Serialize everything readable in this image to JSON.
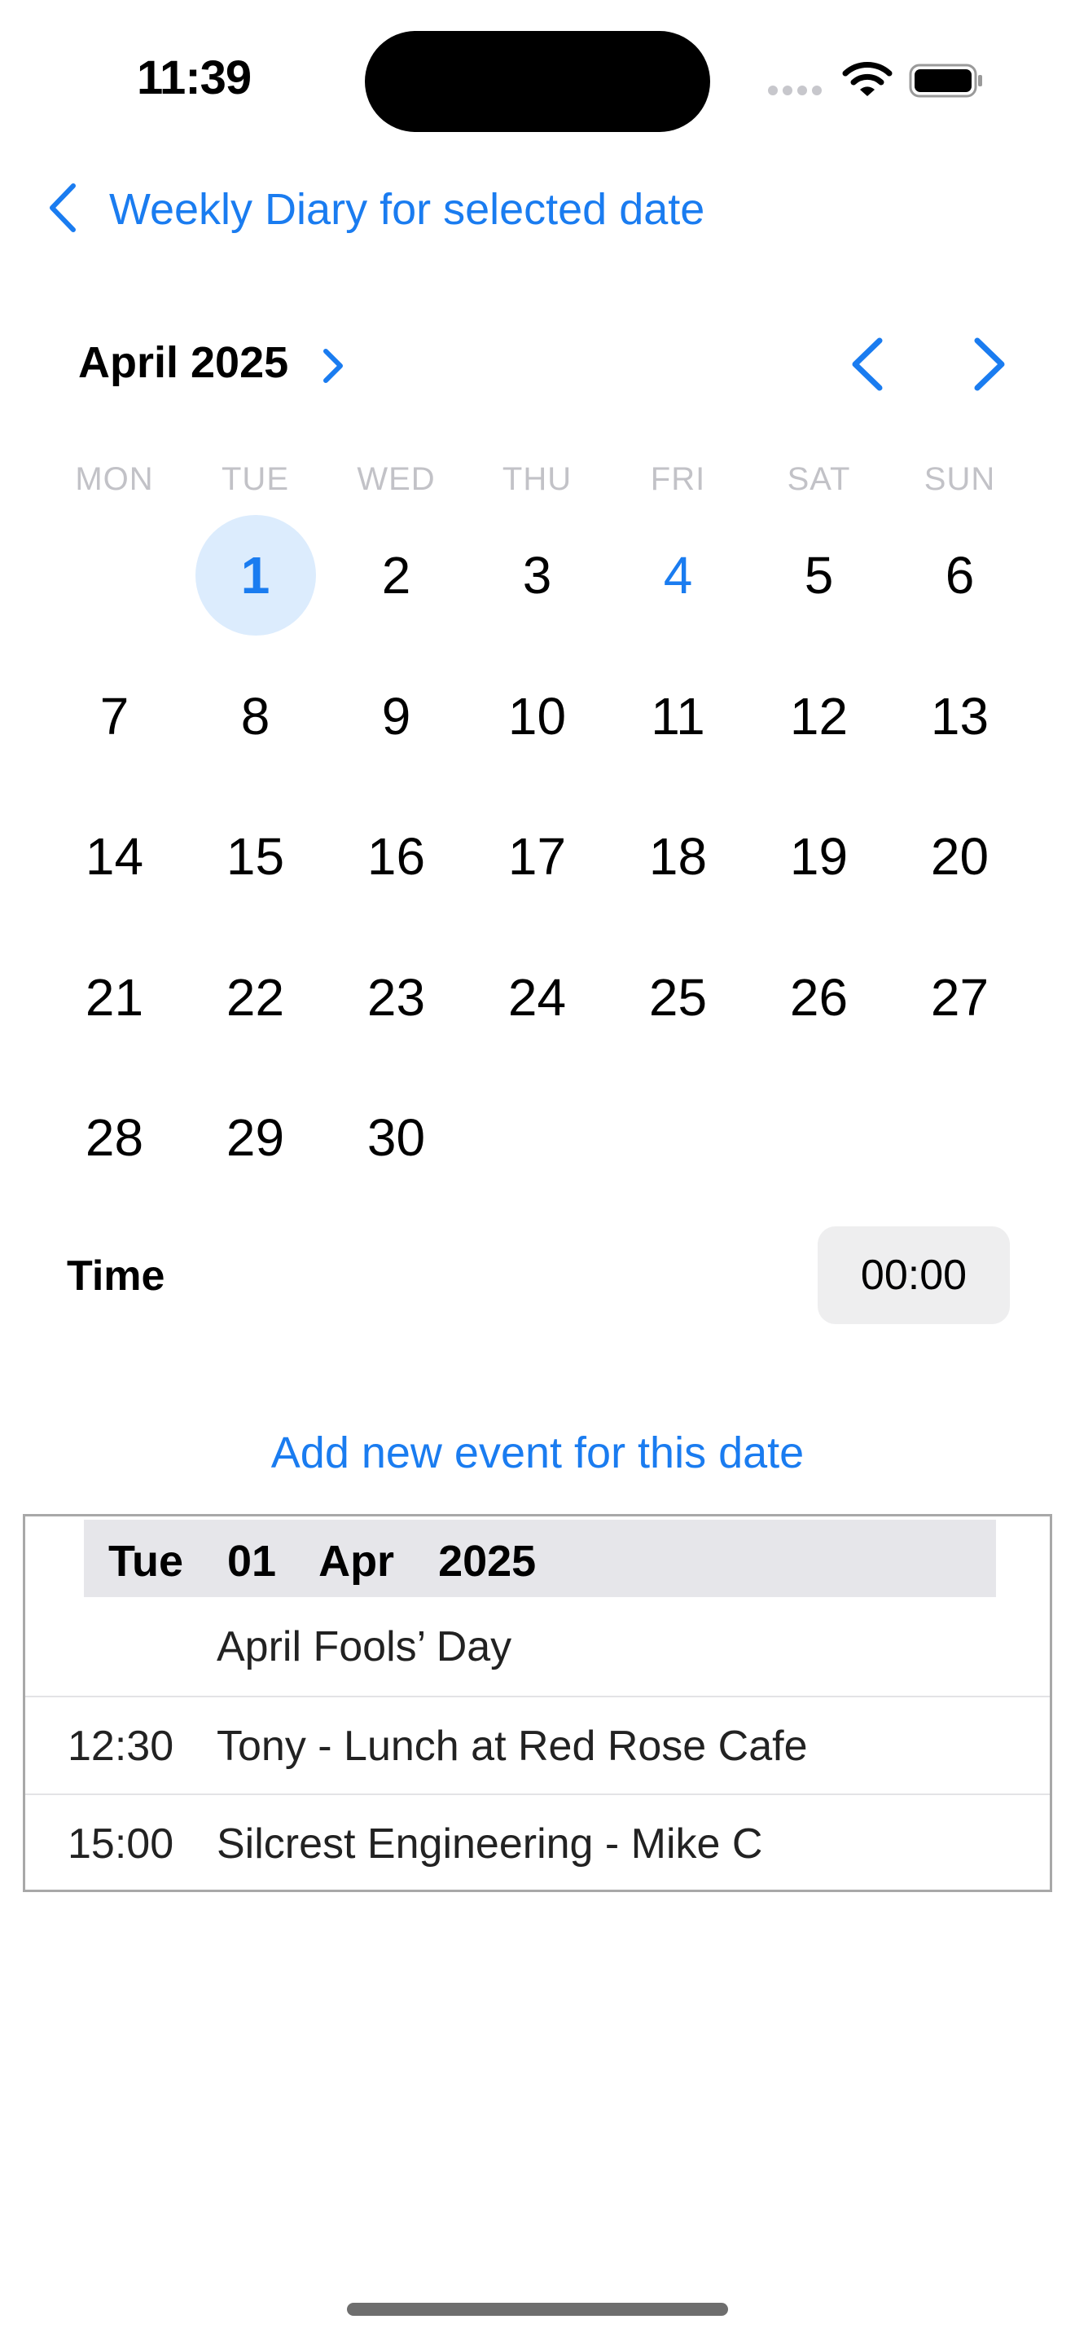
{
  "status_bar": {
    "time": "11:39"
  },
  "nav": {
    "back_label": "Weekly Diary for selected date"
  },
  "calendar": {
    "month_label": "April 2025",
    "weekdays": [
      "MON",
      "TUE",
      "WED",
      "THU",
      "FRI",
      "SAT",
      "SUN"
    ],
    "leading_blank_days": 1,
    "days_in_month": 30,
    "selected_day": 1,
    "highlighted_day": 4,
    "accent_color": "#1a7cf0",
    "selected_bg_color": "#dcecfd"
  },
  "time_row": {
    "label": "Time",
    "value": "00:00"
  },
  "add_event_label": "Add new event for this date",
  "events_panel": {
    "date_header": "Tue  01  Apr  2025",
    "events": [
      {
        "time": "",
        "title": "April Fools’ Day"
      },
      {
        "time": "12:30",
        "title": "Tony - Lunch at Red Rose Cafe"
      },
      {
        "time": "15:00",
        "title": "Silcrest Engineering - Mike C"
      }
    ]
  },
  "icons": {
    "back": "chevron-left-icon",
    "month_expand": "chevron-right-icon",
    "prev_month": "chevron-left-icon",
    "next_month": "chevron-right-icon",
    "wifi": "wifi-icon",
    "battery": "battery-icon",
    "signal": "cellular-signal-icon"
  }
}
